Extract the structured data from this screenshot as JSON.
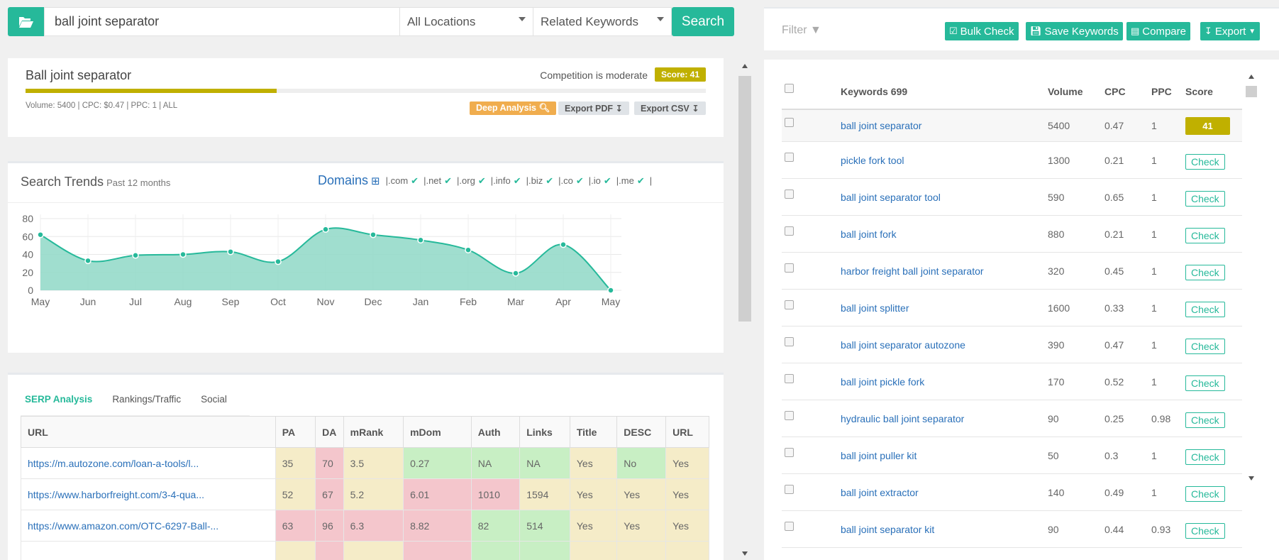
{
  "search": {
    "query": "ball joint separator",
    "location": "All Locations",
    "mode": "Related Keywords",
    "button": "Search"
  },
  "summary": {
    "title": "Ball joint separator",
    "competition": "Competition is moderate",
    "score": "Score: 41",
    "progress_pct": 41,
    "meta": "Volume: 5400 | CPC: $0.47 | PPC: 1 | ALL",
    "deep_analysis": "Deep Analysis",
    "export_pdf": "Export PDF",
    "export_csv": "Export CSV"
  },
  "trends": {
    "title": "Search Trends",
    "subtitle": "Past 12 months",
    "domains_label": "Domains",
    "domains": [
      "|.com",
      "|.net",
      "|.org",
      "|.info",
      "|.biz",
      "|.co",
      "|.io",
      "|.me",
      "|"
    ]
  },
  "chart_data": {
    "type": "area",
    "x": [
      "May",
      "Jun",
      "Jul",
      "Aug",
      "Sep",
      "Oct",
      "Nov",
      "Dec",
      "Jan",
      "Feb",
      "Mar",
      "Apr",
      "May"
    ],
    "values": [
      62,
      33,
      39,
      40,
      43,
      32,
      68,
      62,
      56,
      45,
      19,
      51,
      0
    ],
    "ylim": [
      0,
      80
    ],
    "yticks": [
      0,
      20,
      40,
      60,
      80
    ],
    "color": "#26b99a",
    "fill": "#8fd8c7",
    "grid": true
  },
  "serp": {
    "tabs": [
      "SERP Analysis",
      "Rankings/Traffic",
      "Social"
    ],
    "columns": [
      "URL",
      "PA",
      "DA",
      "mRank",
      "mDom",
      "Auth",
      "Links",
      "Title",
      "DESC",
      "URL"
    ],
    "rows": [
      {
        "cells": [
          "https://m.autozone.com/loan-a-tools/l...",
          "35",
          "70",
          "3.5",
          "0.27",
          "NA",
          "NA",
          "Yes",
          "No",
          "Yes"
        ],
        "colors": [
          "",
          "y",
          "r",
          "y",
          "g",
          "g",
          "g",
          "y",
          "g",
          "y"
        ]
      },
      {
        "cells": [
          "https://www.harborfreight.com/3-4-qua...",
          "52",
          "67",
          "5.2",
          "6.01",
          "1010",
          "1594",
          "Yes",
          "Yes",
          "Yes"
        ],
        "colors": [
          "",
          "y",
          "r",
          "y",
          "r",
          "r",
          "y",
          "y",
          "y",
          "y"
        ]
      },
      {
        "cells": [
          "https://www.amazon.com/OTC-6297-Ball-...",
          "63",
          "96",
          "6.3",
          "8.82",
          "82",
          "514",
          "Yes",
          "Yes",
          "Yes"
        ],
        "colors": [
          "",
          "r",
          "r",
          "r",
          "r",
          "g",
          "g",
          "y",
          "y",
          "y"
        ]
      },
      {
        "cells": [
          "",
          "",
          "",
          "",
          "",
          "",
          "",
          "",
          "",
          ""
        ],
        "colors": [
          "",
          "y",
          "r",
          "y",
          "r",
          "g",
          "g",
          "y",
          "y",
          "y"
        ]
      }
    ]
  },
  "right": {
    "filter": "Filter",
    "bulk_check": "Bulk Check",
    "save_keywords": "Save Keywords",
    "compare": "Compare",
    "export": "Export",
    "headers": {
      "keywords": "Keywords 699",
      "volume": "Volume",
      "cpc": "CPC",
      "ppc": "PPC",
      "score": "Score"
    },
    "rows": [
      {
        "kw": "ball joint separator",
        "vol": "5400",
        "cpc": "0.47",
        "ppc": "1",
        "score": "41"
      },
      {
        "kw": "pickle fork tool",
        "vol": "1300",
        "cpc": "0.21",
        "ppc": "1",
        "score": "Check"
      },
      {
        "kw": "ball joint separator tool",
        "vol": "590",
        "cpc": "0.65",
        "ppc": "1",
        "score": "Check"
      },
      {
        "kw": "ball joint fork",
        "vol": "880",
        "cpc": "0.21",
        "ppc": "1",
        "score": "Check"
      },
      {
        "kw": "harbor freight ball joint separator",
        "vol": "320",
        "cpc": "0.45",
        "ppc": "1",
        "score": "Check"
      },
      {
        "kw": "ball joint splitter",
        "vol": "1600",
        "cpc": "0.33",
        "ppc": "1",
        "score": "Check"
      },
      {
        "kw": "ball joint separator autozone",
        "vol": "390",
        "cpc": "0.47",
        "ppc": "1",
        "score": "Check"
      },
      {
        "kw": "ball joint pickle fork",
        "vol": "170",
        "cpc": "0.52",
        "ppc": "1",
        "score": "Check"
      },
      {
        "kw": "hydraulic ball joint separator",
        "vol": "90",
        "cpc": "0.25",
        "ppc": "0.98",
        "score": "Check"
      },
      {
        "kw": "ball joint puller kit",
        "vol": "50",
        "cpc": "0.3",
        "ppc": "1",
        "score": "Check"
      },
      {
        "kw": "ball joint extractor",
        "vol": "140",
        "cpc": "0.49",
        "ppc": "1",
        "score": "Check"
      },
      {
        "kw": "ball joint separator kit",
        "vol": "90",
        "cpc": "0.44",
        "ppc": "0.93",
        "score": "Check"
      }
    ]
  }
}
